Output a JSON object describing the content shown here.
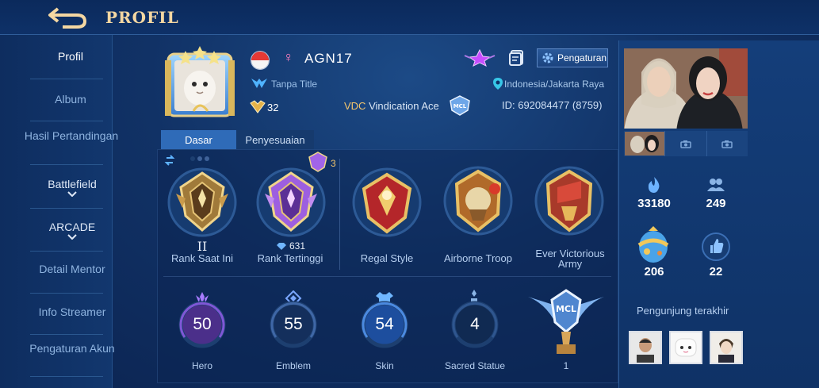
{
  "header": {
    "title": "PROFIL"
  },
  "sidebar": {
    "items": [
      {
        "label": "Profil"
      },
      {
        "label": "Album"
      },
      {
        "label": "Hasil Pertandingan"
      },
      {
        "label": "Battlefield"
      },
      {
        "label": "ARCADE"
      },
      {
        "label": "Detail Mentor"
      },
      {
        "label": "Info Streamer"
      },
      {
        "label": "Pengaturan Akun"
      }
    ]
  },
  "profile": {
    "gender_symbol": "♀",
    "name": "AGN17",
    "title": "Tanpa Title",
    "level": "32",
    "squad_tag": "VDC",
    "squad_name": "Vindication Ace",
    "location": "Indonesia/Jakarta Raya",
    "id": "ID: 692084477 (8759)",
    "settings_label": "Pengaturan"
  },
  "tabs": [
    {
      "label": "Dasar"
    },
    {
      "label": "Penyesuaian"
    }
  ],
  "ranks": {
    "small_badge_count": "3",
    "current": {
      "tier": "II",
      "label": "Rank Saat Ini"
    },
    "highest": {
      "points": "631",
      "label": "Rank Tertinggi"
    }
  },
  "medals": [
    {
      "label": "Regal Style"
    },
    {
      "label": "Airborne Troop"
    },
    {
      "label": "Ever Victorious Army"
    }
  ],
  "stats": [
    {
      "value": "50",
      "label": "Hero",
      "color": "#a77cff"
    },
    {
      "value": "55",
      "label": "Emblem",
      "color": "#7aa7ff"
    },
    {
      "value": "54",
      "label": "Skin",
      "color": "#6fb6ff"
    },
    {
      "value": "4",
      "label": "Sacred Statue",
      "color": "#8ab4e6"
    }
  ],
  "trophy": {
    "count": "1"
  },
  "right": {
    "popularity": "33180",
    "followers": "249",
    "gifts": "206",
    "likes": "22",
    "visitors_title": "Pengunjung terakhir"
  }
}
